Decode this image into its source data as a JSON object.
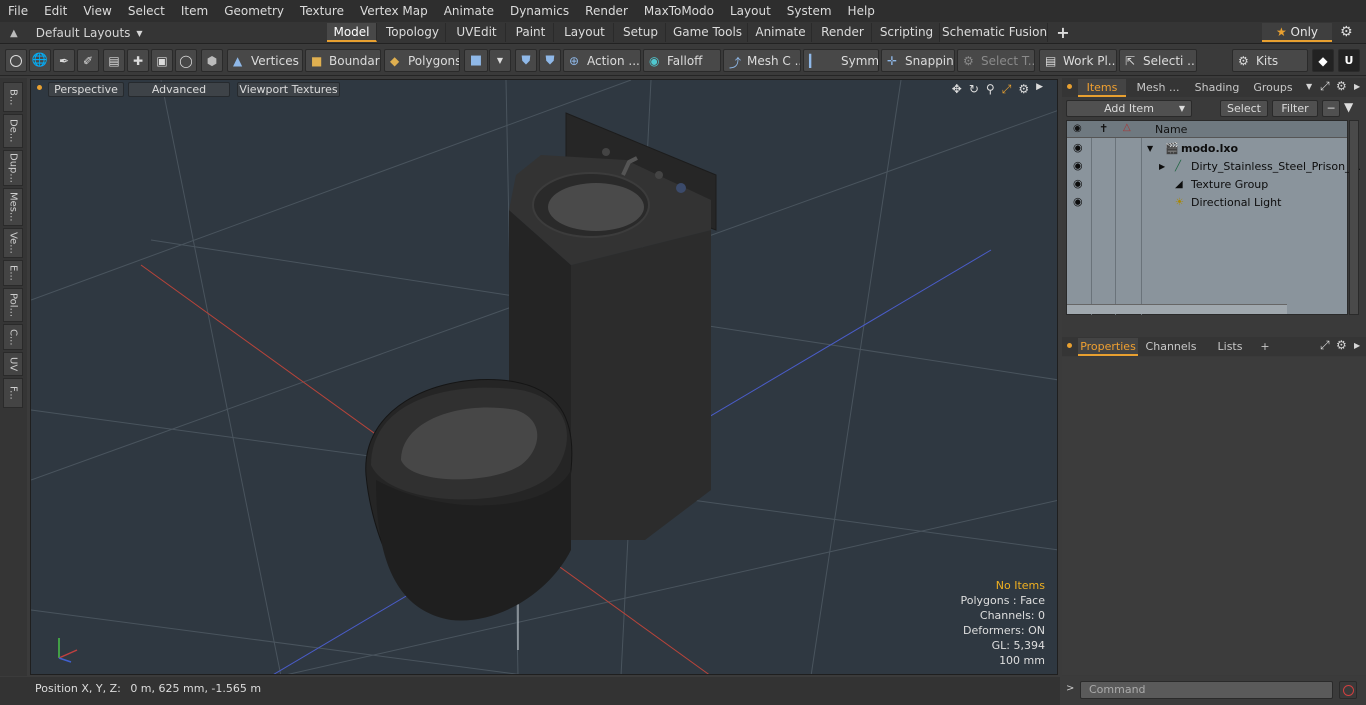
{
  "menu": [
    "File",
    "Edit",
    "View",
    "Select",
    "Item",
    "Geometry",
    "Texture",
    "Vertex Map",
    "Animate",
    "Dynamics",
    "Render",
    "MaxToModo",
    "Layout",
    "System",
    "Help"
  ],
  "layouts_label": "Default Layouts",
  "tabs": [
    "Model",
    "Topology",
    "UVEdit",
    "Paint",
    "Layout",
    "Setup",
    "Game Tools",
    "Animate",
    "Render",
    "Scripting",
    "Schematic Fusion"
  ],
  "active_tab": "Model",
  "only_label": "Only",
  "toolbar": {
    "vertices": "Vertices",
    "boundary": "Boundary",
    "polygons": "Polygons",
    "action": "Action ...",
    "falloff": "Falloff",
    "mesh": "Mesh C ...",
    "symm": "Symm ...",
    "snapping": "Snapping",
    "select_t": "Select T...",
    "work_pl": "Work Pl...",
    "selecti": "Selecti ...",
    "kits": "Kits"
  },
  "left_tools": [
    "B...",
    "De...",
    "Dup...",
    "Mes...",
    "Ve...",
    "E...",
    "Pol...",
    "C...",
    "UV",
    "F..."
  ],
  "viewport": {
    "perspective": "Perspective",
    "advanced": "Advanced",
    "viewport_textures": "Viewport Textures",
    "info": {
      "no_items": "No Items",
      "polygons": "Polygons : Face",
      "channels": "Channels: 0",
      "deformers": "Deformers: ON",
      "gl": "GL: 5,394",
      "scale": "100 mm"
    }
  },
  "status": {
    "position_label": "Position X, Y, Z:",
    "position_value": "0 m, 625 mm, -1.565 m"
  },
  "items_panel": {
    "tabs": [
      "Items",
      "Mesh ...",
      "Shading",
      "Groups"
    ],
    "add_item": "Add Item",
    "select": "Select",
    "filter": "Filter",
    "name_header": "Name",
    "rows": [
      "modo.lxo",
      "Dirty_Stainless_Steel_Prison_...",
      "Texture Group",
      "Directional Light"
    ]
  },
  "props_panel": {
    "tabs": [
      "Properties",
      "Channels",
      "Lists"
    ],
    "plus": "+"
  },
  "command_placeholder": "Command",
  "colors": {
    "accent": "#e8a030",
    "viewport_bg": "#2f3841",
    "axis_x": "#c0392b",
    "axis_z": "#4060d0",
    "axis_y": "#40c040"
  }
}
